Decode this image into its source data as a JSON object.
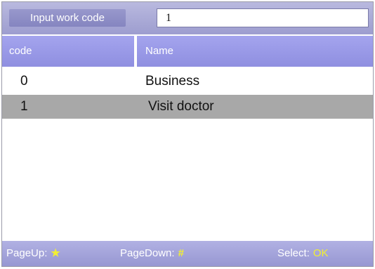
{
  "input": {
    "label": "Input work code",
    "value": "1"
  },
  "table": {
    "headers": {
      "code": "code",
      "name": "Name"
    },
    "rows": [
      {
        "code": "0",
        "name": "Business",
        "selected": false
      },
      {
        "code": "1",
        "name": "Visit doctor",
        "selected": true
      }
    ]
  },
  "footer": {
    "pageup_label": "PageUp:",
    "pageup_key": "★",
    "pagedown_label": "PageDown:",
    "pagedown_key": "#",
    "select_label": "Select:",
    "select_key": "OK"
  },
  "colors": {
    "accent_bar": "#9d9dcf",
    "header_bar": "#9898e8",
    "selected_row": "#a8a8a8",
    "key_highlight": "#f2ef32"
  }
}
